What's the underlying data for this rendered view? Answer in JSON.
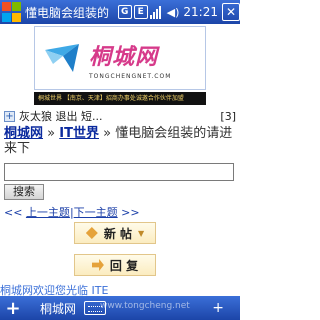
{
  "statusbar": {
    "title": "懂电脑会组装的",
    "icon_g": "G",
    "icon_e": "E",
    "clock": "21:21",
    "close": "✕"
  },
  "banner": {
    "logo_cn": "桐城网",
    "logo_en": "TONGCHENGNET.COM",
    "ad_text": "桐城世界 【南京、天津】招商办事处诚邀合作伙伴加盟"
  },
  "line1": {
    "text": "灰太狼 退出 短...",
    "count": "[3]"
  },
  "breadcrumb": {
    "site": "桐城网",
    "sep1": "»",
    "section": "IT世界",
    "sep2": "»",
    "topic": "懂电脑会组装的请进来下"
  },
  "search_label": "搜索",
  "nav": {
    "prefix": "<< ",
    "prev": "上一主题",
    "sep": "|",
    "next": "下一主题",
    "suffix": " >>"
  },
  "buttons": {
    "new_post": "新 帖",
    "reply": "回 复"
  },
  "marquee": "桐城网欢迎您光临 ITE",
  "menubar": {
    "left": "+",
    "text": "桐城网",
    "url": "www.tongcheng.net",
    "right": "+"
  },
  "colors": {
    "bar_top": "#3b6fd8",
    "bar_bottom": "#1c45a8",
    "link": "#0b2a9e",
    "logo_pink": "#d63a8a"
  }
}
